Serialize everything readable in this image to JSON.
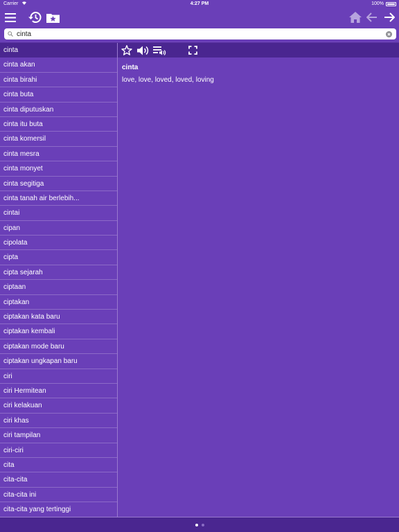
{
  "status_bar": {
    "carrier": "Carrier",
    "time": "4:27 PM",
    "battery": "100%"
  },
  "toolbar": {
    "icons": [
      "menu-icon",
      "history-icon",
      "favorites-folder-icon",
      "home-icon",
      "back-arrow-icon",
      "forward-arrow-icon"
    ]
  },
  "search": {
    "value": "cinta",
    "placeholder": ""
  },
  "word_list": [
    "cinta",
    "cinta akan",
    "cinta birahi",
    "cinta buta",
    "cinta diputuskan",
    "cinta itu buta",
    "cinta komersil",
    "cinta mesra",
    "cinta monyet",
    "cinta segitiga",
    "cinta tanah air berlebih...",
    "cintai",
    "cipan",
    "cipolata",
    "cipta",
    "cipta sejarah",
    "ciptaan",
    "ciptakan",
    "ciptakan kata baru",
    "ciptakan kembali",
    "ciptakan mode baru",
    "ciptakan ungkapan baru",
    "ciri",
    "ciri Hermitean",
    "ciri kelakuan",
    "ciri khas",
    "ciri tampilan",
    "ciri-ciri",
    "cita",
    "cita-cita",
    "cita-cita ini",
    "cita-cita yang tertinggi"
  ],
  "selected_index": 0,
  "detail_toolbar": {
    "icons": [
      "star-icon",
      "speaker-icon",
      "playlist-audio-icon",
      "fullscreen-icon"
    ]
  },
  "entry": {
    "headword": "cinta",
    "translation": "love, love, loved, loved, loving"
  },
  "pager": {
    "pages": 2,
    "current": 0
  },
  "colors": {
    "background": "#6a3fb8",
    "selected": "#4a2690",
    "separator": "#8d6ac8"
  }
}
